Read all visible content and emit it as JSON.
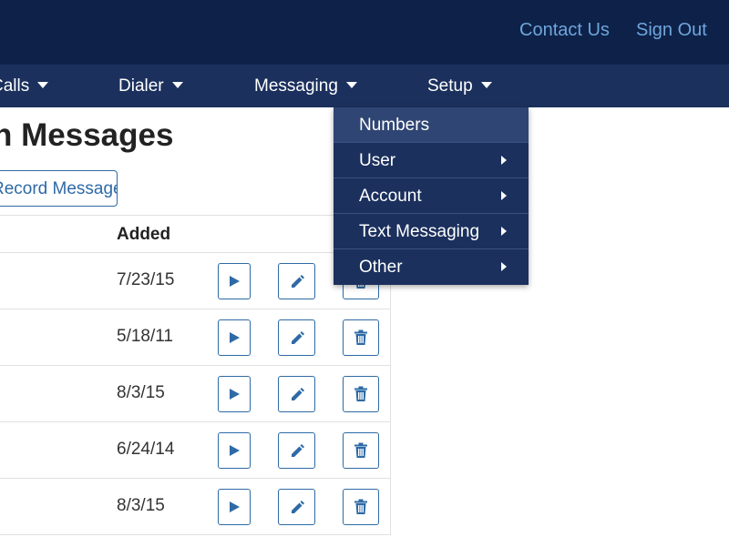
{
  "topbar": {
    "contact_label": "Contact Us",
    "signout_label": "Sign Out"
  },
  "nav": {
    "calls_label": "Calls",
    "dialer_label": "Dialer",
    "messaging_label": "Messaging",
    "setup_label": "Setup"
  },
  "page": {
    "title": "n Messages",
    "record_button": "Record Message"
  },
  "table": {
    "columns": [
      "Added"
    ],
    "rows": [
      {
        "added": "7/23/15"
      },
      {
        "added": "5/18/11"
      },
      {
        "added": "8/3/15"
      },
      {
        "added": "6/24/14"
      },
      {
        "added": "8/3/15"
      }
    ],
    "row_actions": [
      "play-icon",
      "pencil-icon",
      "trash-icon"
    ]
  },
  "setup_menu": {
    "items": [
      {
        "label": "Numbers",
        "submenu": false
      },
      {
        "label": "User",
        "submenu": true
      },
      {
        "label": "Account",
        "submenu": true
      },
      {
        "label": "Text Messaging",
        "submenu": true
      },
      {
        "label": "Other",
        "submenu": true
      }
    ]
  },
  "colors": {
    "topbar": "#0e2249",
    "navbar": "#1b305d",
    "accent": "#2e6aa6",
    "link": "#6fa6dc"
  }
}
